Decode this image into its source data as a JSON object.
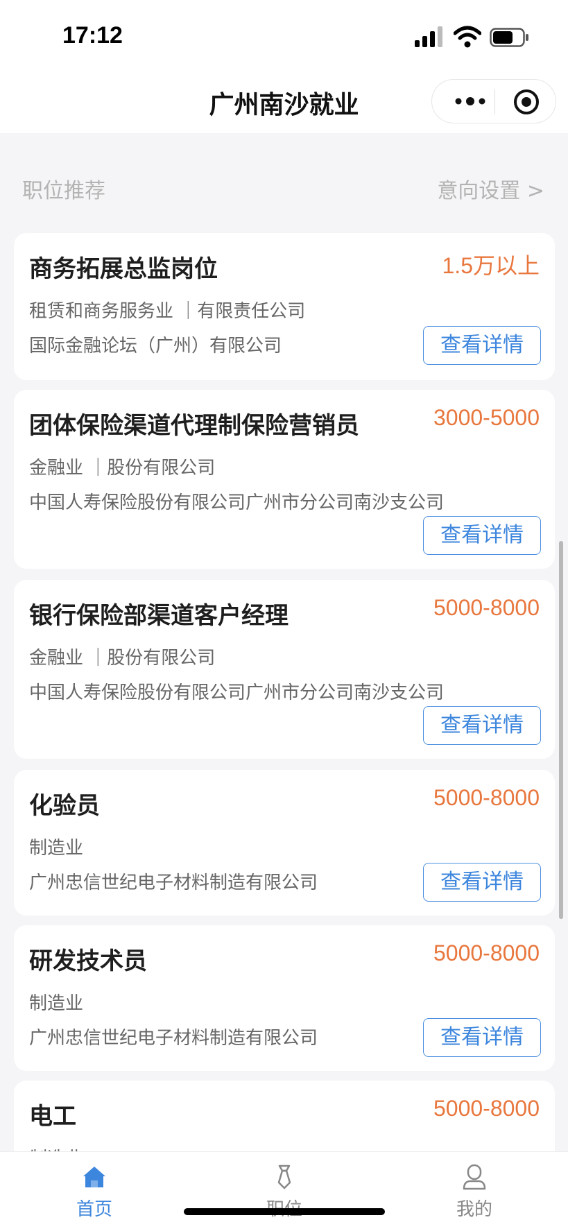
{
  "status_bar": {
    "time": "17:12",
    "icons": [
      "signal-icon",
      "wifi-icon",
      "battery-icon"
    ]
  },
  "nav": {
    "title": "广州南沙就业",
    "capsule_icons": [
      "more-icon",
      "close-mini-program-icon"
    ]
  },
  "section": {
    "title": "职位推荐",
    "preference_link": "意向设置 >"
  },
  "jobs": [
    {
      "title": "商务拓展总监岗位",
      "salary": "1.5万以上",
      "meta": "租赁和商务服务业 ｜有限责任公司",
      "company": "国际金融论坛（广州）有限公司",
      "button": "查看详情"
    },
    {
      "title": "团体保险渠道代理制保险营销员",
      "salary": "3000-5000",
      "meta": "金融业 ｜股份有限公司",
      "company": "中国人寿保险股份有限公司广州市分公司南沙支公司",
      "button": "查看详情"
    },
    {
      "title": "银行保险部渠道客户经理",
      "salary": "5000-8000",
      "meta": "金融业 ｜股份有限公司",
      "company": "中国人寿保险股份有限公司广州市分公司南沙支公司",
      "button": "查看详情"
    },
    {
      "title": "化验员",
      "salary": "5000-8000",
      "meta": "制造业",
      "company": "广州忠信世纪电子材料制造有限公司",
      "button": "查看详情"
    },
    {
      "title": "研发技术员",
      "salary": "5000-8000",
      "meta": "制造业",
      "company": "广州忠信世纪电子材料制造有限公司",
      "button": "查看详情"
    },
    {
      "title": "电工",
      "salary": "5000-8000",
      "meta": "制造业",
      "company": "",
      "button": ""
    }
  ],
  "tab_bar": {
    "tabs": [
      {
        "label": "首页",
        "icon": "home-icon",
        "active": true
      },
      {
        "label": "职位",
        "icon": "tie-icon",
        "active": false
      },
      {
        "label": "我的",
        "icon": "user-icon",
        "active": false
      }
    ]
  },
  "colors": {
    "accent": "#3d86dd",
    "salary": "#e8773e",
    "background": "#f5f5f7"
  }
}
